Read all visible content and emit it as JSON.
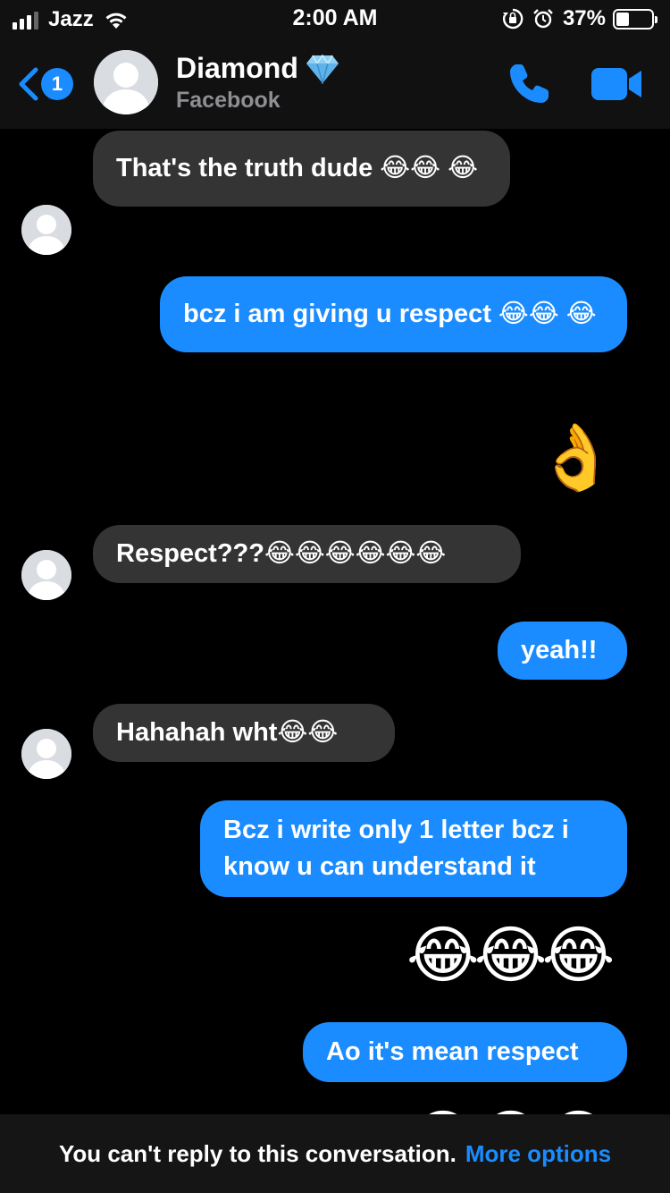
{
  "status_bar": {
    "carrier": "Jazz",
    "time": "2:00 AM",
    "battery_percent": "37%",
    "battery_level": 0.37,
    "icons": [
      "signal-icon",
      "wifi-icon",
      "orientation-lock-icon",
      "alarm-icon",
      "battery-icon"
    ]
  },
  "header": {
    "back_badge": "1",
    "contact_name": "Diamond",
    "contact_emoji": "gem-icon",
    "subtitle": "Facebook",
    "icons": [
      "back-chevron-icon",
      "phone-icon",
      "video-camera-icon"
    ]
  },
  "messages": [
    {
      "direction": "in",
      "text": "That's the truth dude 😂😂 😂"
    },
    {
      "direction": "out",
      "text": "bcz i am giving u respect 😂😂 😂"
    },
    {
      "direction": "out",
      "type": "emoji",
      "text": "👌"
    },
    {
      "direction": "in",
      "text": "Respect???😂😂😂😂😂😂"
    },
    {
      "direction": "out",
      "text": "yeah!!"
    },
    {
      "direction": "in",
      "text": "Hahahah wht😂😂"
    },
    {
      "direction": "out",
      "text": "Bcz i write only 1 letter bcz i know u can understand it"
    },
    {
      "direction": "out",
      "type": "emoji",
      "text": "😂😂😂"
    },
    {
      "direction": "out",
      "text": "Ao it's mean respect"
    },
    {
      "direction": "out",
      "type": "emoji",
      "text": "😂😂😂"
    }
  ],
  "footer": {
    "notice": "You can't reply to this conversation.",
    "link": "More options"
  },
  "colors": {
    "accent": "#1a8cff",
    "incoming_bubble": "#343434",
    "background": "#000000"
  }
}
